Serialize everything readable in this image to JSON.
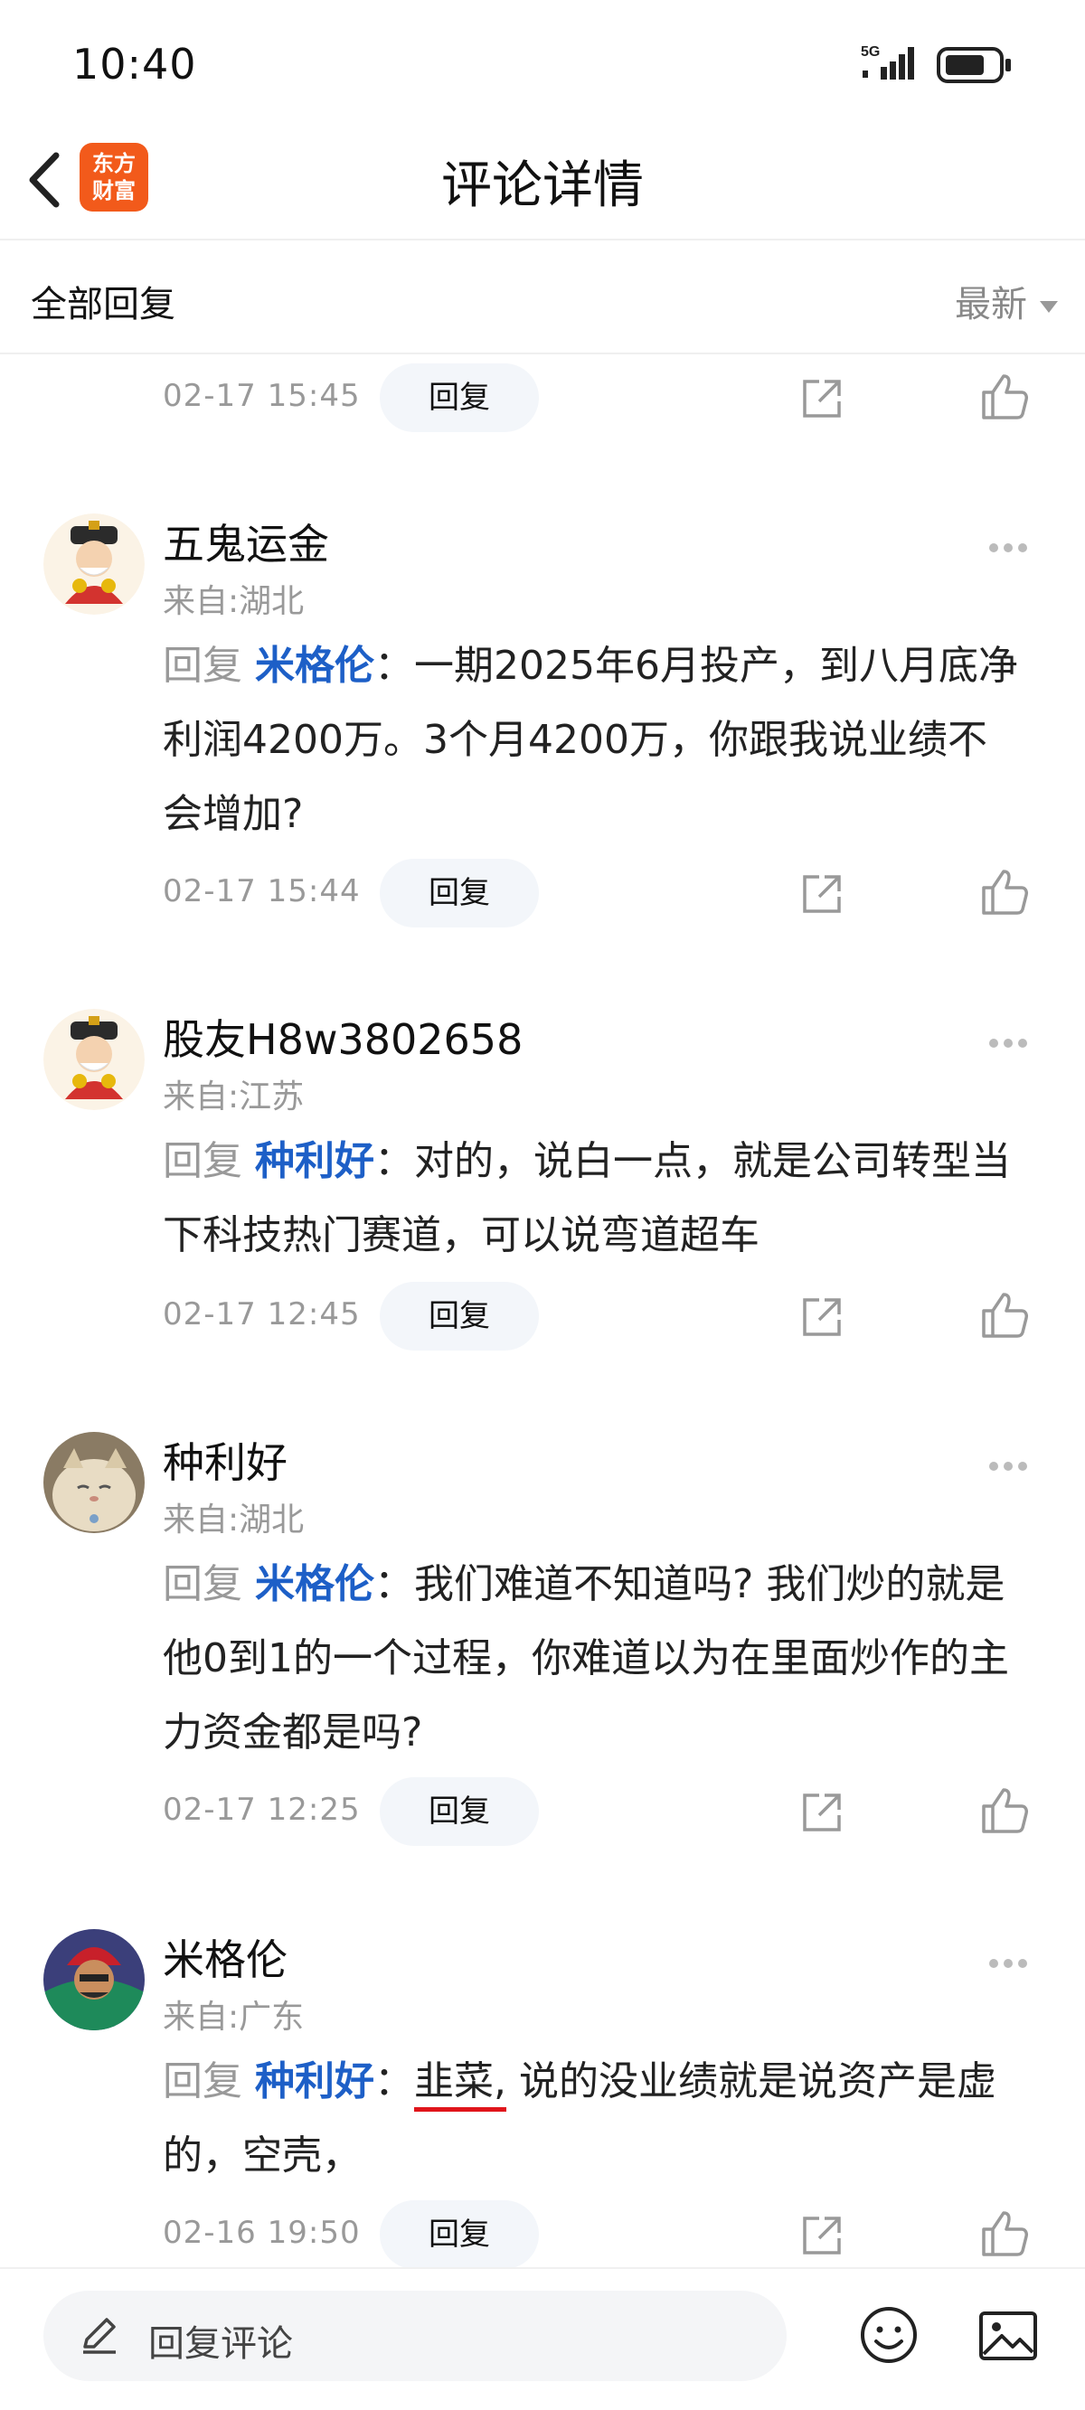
{
  "status_bar": {
    "time": "10:40",
    "network": "5G"
  },
  "nav": {
    "title": "评论详情",
    "logo_line1": "东方",
    "logo_line2": "财富"
  },
  "filter": {
    "left_label": "全部回复",
    "sort_label": "最新"
  },
  "reply_label": "回复",
  "partial_top": {
    "date": "02-17 15:45"
  },
  "comments": [
    {
      "user": "五鬼运金",
      "location": "来自:湖北",
      "lead": "回复",
      "mention": "米格伦",
      "text": "：一期2025年6月投产，到八月底净利润4200万。3个月4200万，你跟我说业绩不会增加?",
      "date": "02-17 15:44"
    },
    {
      "user": "股友H8w3802658",
      "location": "来自:江苏",
      "lead": "回复",
      "mention": "种利好",
      "text": "：对的，说白一点，就是公司转型当下科技热门赛道，可以说弯道超车",
      "date": "02-17 12:45"
    },
    {
      "user": "种利好",
      "location": "来自:湖北",
      "lead": "回复",
      "mention": "米格伦",
      "text": "：我们难道不知道吗? 我们炒的就是他0到1的一个过程，你难道以为在里面炒作的主力资金都是吗?",
      "date": "02-17 12:25"
    },
    {
      "user": "米格伦",
      "location": "来自:广东",
      "lead": "回复",
      "mention": "种利好",
      "text_prefix": "：",
      "text_underlined": "韭菜,",
      "text_rest": " 说的没业绩就是说资产是虚的，空壳，",
      "date": "02-16 19:50"
    }
  ],
  "bottom": {
    "placeholder": "回复评论"
  }
}
